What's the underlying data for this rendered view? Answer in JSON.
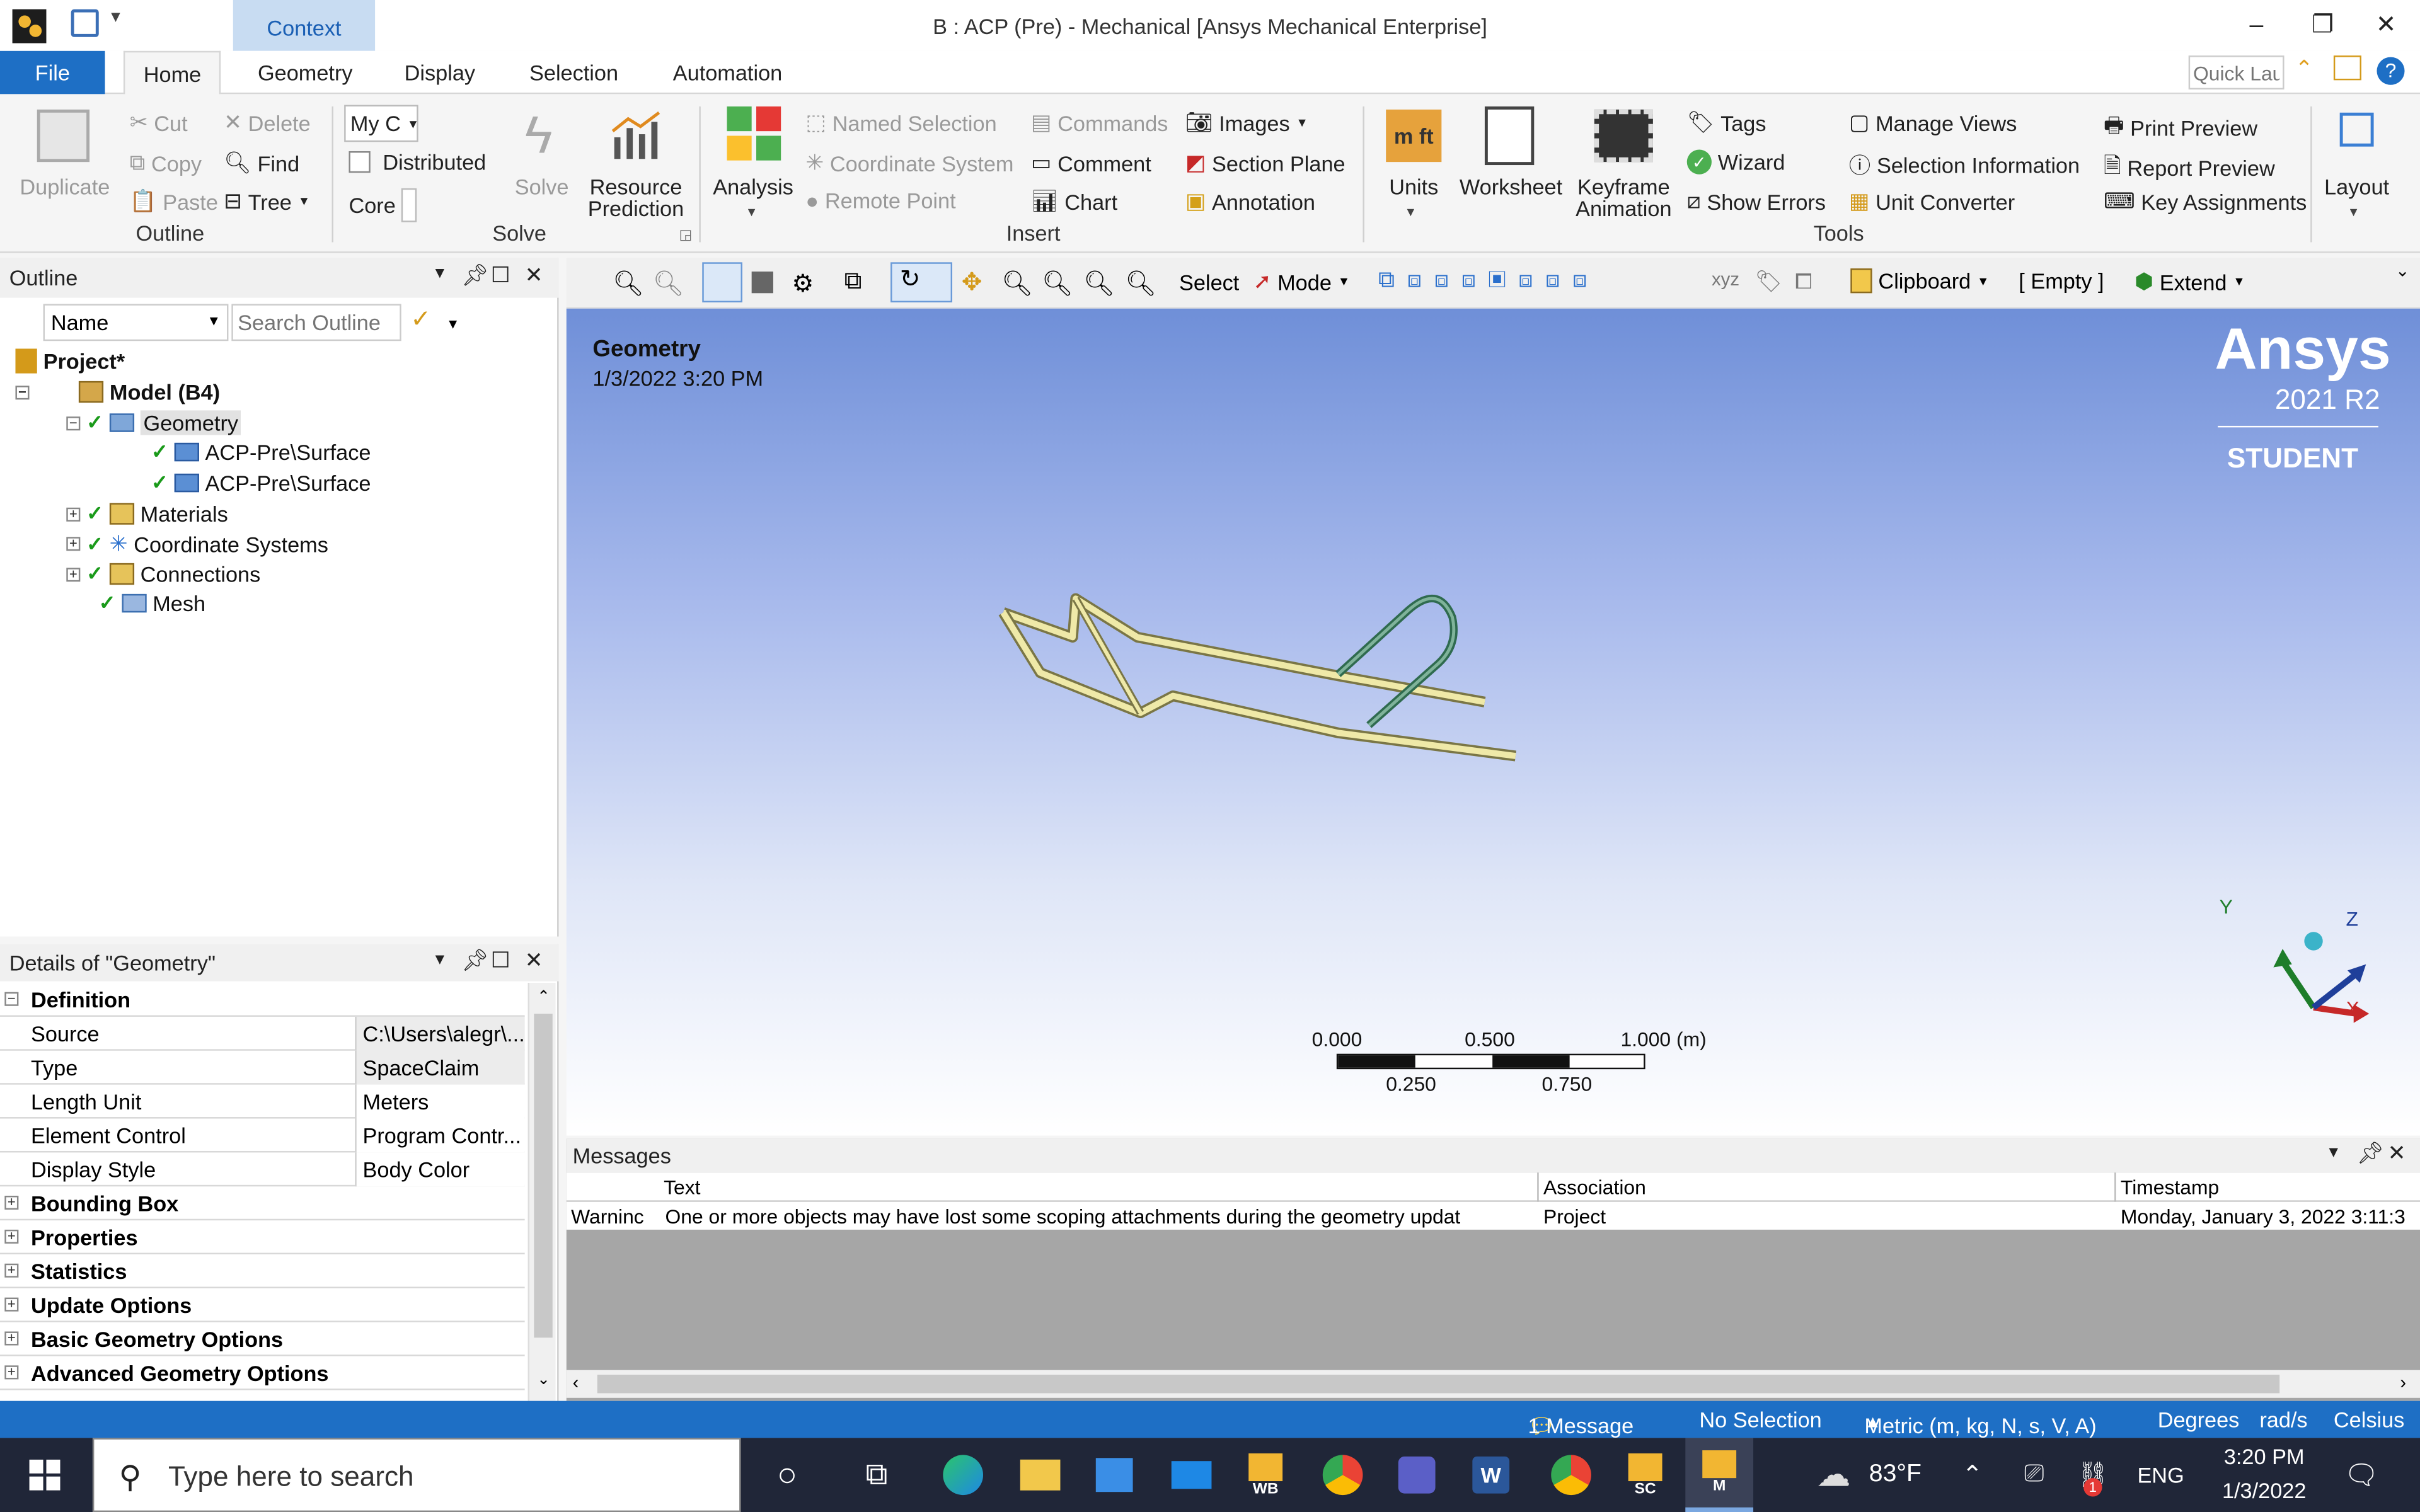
{
  "window": {
    "title": "B : ACP (Pre) - Mechanical [Ansys Mechanical Enterprise]",
    "context_tab": "Context",
    "minimize": "–",
    "restore": "❐",
    "close": "✕"
  },
  "ribbon_tabs": {
    "file": "File",
    "items": [
      "Home",
      "Geometry",
      "Display",
      "Selection",
      "Automation"
    ],
    "quick_launch_placeholder": "Quick Lau"
  },
  "ribbon": {
    "outline_group": {
      "label": "Outline",
      "duplicate": "Duplicate",
      "cut": "Cut",
      "copy": "Copy",
      "paste": "Paste",
      "delete": "Delete",
      "find": "Find",
      "tree": "Tree"
    },
    "solve_group": {
      "label": "Solve",
      "my_computer": "My C",
      "distributed": "Distributed",
      "cores": "Core",
      "solve": "Solve",
      "resource_prediction_1": "Resource",
      "resource_prediction_2": "Prediction"
    },
    "insert_group": {
      "label": "Insert",
      "analysis": "Analysis",
      "named_selection": "Named Selection",
      "coordinate_system": "Coordinate System",
      "remote_point": "Remote Point",
      "commands": "Commands",
      "comment": "Comment",
      "chart": "Chart",
      "images": "Images",
      "section_plane": "Section Plane",
      "annotation": "Annotation"
    },
    "tools_group": {
      "label": "Tools",
      "units": "Units",
      "worksheet": "Worksheet",
      "keyframe_1": "Keyframe",
      "keyframe_2": "Animation",
      "tags": "Tags",
      "wizard": "Wizard",
      "show_errors": "Show Errors",
      "manage_views": "Manage Views",
      "selection_information": "Selection Information",
      "unit_converter": "Unit Converter",
      "print_preview": "Print Preview",
      "report_preview": "Report Preview",
      "key_assignments": "Key Assignments"
    },
    "layout": "Layout"
  },
  "outline": {
    "title": "Outline",
    "name_filter": "Name",
    "search_placeholder": "Search Outline",
    "tree": [
      {
        "label": "Project*"
      },
      {
        "label": "Model (B4)"
      },
      {
        "label": "Geometry"
      },
      {
        "label": "ACP-Pre\\Surface"
      },
      {
        "label": "ACP-Pre\\Surface"
      },
      {
        "label": "Materials"
      },
      {
        "label": "Coordinate Systems"
      },
      {
        "label": "Connections"
      },
      {
        "label": "Mesh"
      }
    ]
  },
  "details": {
    "title": "Details of \"Geometry\"",
    "rows": [
      {
        "key": "Definition"
      },
      {
        "key": "Source",
        "value": "C:\\Users\\alegr\\..."
      },
      {
        "key": "Type",
        "value": "SpaceClaim"
      },
      {
        "key": "Length Unit",
        "value": "Meters"
      },
      {
        "key": "Element Control",
        "value": "Program Contr..."
      },
      {
        "key": "Display Style",
        "value": "Body Color"
      },
      {
        "key": "Bounding Box"
      },
      {
        "key": "Properties"
      },
      {
        "key": "Statistics"
      },
      {
        "key": "Update Options"
      },
      {
        "key": "Basic Geometry Options"
      },
      {
        "key": "Advanced Geometry Options"
      }
    ]
  },
  "graphics_toolbar": {
    "select": "Select",
    "mode": "Mode",
    "clipboard": "Clipboard",
    "empty": "[ Empty ]",
    "extend": "Extend"
  },
  "viewport": {
    "label": "Geometry",
    "timestamp": "1/3/2022 3:20 PM",
    "brand": "Ansys",
    "version": "2021 R2",
    "edition": "STUDENT",
    "scale": {
      "t0": "0.000",
      "t1": "0.500",
      "t2": "1.000 (m)",
      "b1": "0.250",
      "b2": "0.750"
    },
    "axes": {
      "x": "X",
      "y": "Y",
      "z": "Z"
    },
    "colors": {
      "body_fill": "#efe9a8",
      "body_edge": "#7a7646",
      "loop": "#2f6b4f"
    }
  },
  "messages": {
    "title": "Messages",
    "columns": [
      "Text",
      "Association",
      "Timestamp"
    ],
    "row": {
      "type": "Warninc",
      "text": "One or more objects may have lost some scoping attachments during the geometry updat",
      "association": "Project",
      "timestamp": "Monday, January 3, 2022 3:11:3"
    }
  },
  "statusbar": {
    "messages": "1 Message",
    "selection": "No Selection",
    "units": "Metric (m, kg, N, s, V, A)",
    "degrees": "Degrees",
    "rads": "rad/s",
    "temp": "Celsius"
  },
  "taskbar": {
    "search_placeholder": "Type here to search",
    "weather": "83°F",
    "lang": "ENG",
    "time": "3:20 PM",
    "date": "1/3/2022",
    "app_wb": "WB",
    "app_sc": "SC",
    "app_m": "M",
    "badge": "1"
  },
  "theme": {
    "accent": "#1e6fc5",
    "taskbar": "#202638"
  }
}
